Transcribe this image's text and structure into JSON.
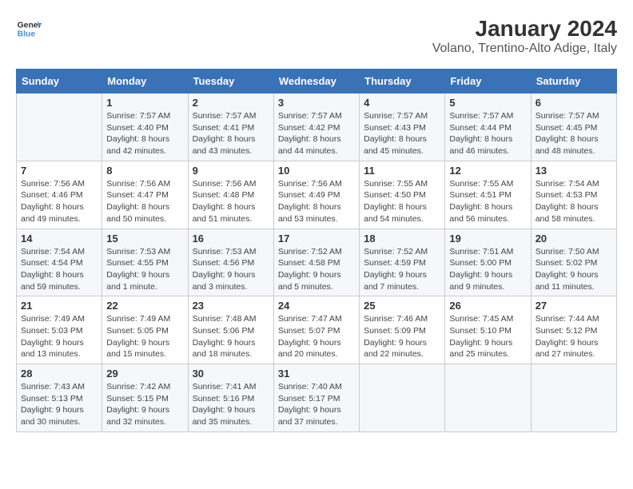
{
  "logo": {
    "line1": "General",
    "line2": "Blue"
  },
  "title": "January 2024",
  "subtitle": "Volano, Trentino-Alto Adige, Italy",
  "days_of_week": [
    "Sunday",
    "Monday",
    "Tuesday",
    "Wednesday",
    "Thursday",
    "Friday",
    "Saturday"
  ],
  "weeks": [
    [
      {
        "day": "",
        "sunrise": "",
        "sunset": "",
        "daylight": ""
      },
      {
        "day": "1",
        "sunrise": "Sunrise: 7:57 AM",
        "sunset": "Sunset: 4:40 PM",
        "daylight": "Daylight: 8 hours and 42 minutes."
      },
      {
        "day": "2",
        "sunrise": "Sunrise: 7:57 AM",
        "sunset": "Sunset: 4:41 PM",
        "daylight": "Daylight: 8 hours and 43 minutes."
      },
      {
        "day": "3",
        "sunrise": "Sunrise: 7:57 AM",
        "sunset": "Sunset: 4:42 PM",
        "daylight": "Daylight: 8 hours and 44 minutes."
      },
      {
        "day": "4",
        "sunrise": "Sunrise: 7:57 AM",
        "sunset": "Sunset: 4:43 PM",
        "daylight": "Daylight: 8 hours and 45 minutes."
      },
      {
        "day": "5",
        "sunrise": "Sunrise: 7:57 AM",
        "sunset": "Sunset: 4:44 PM",
        "daylight": "Daylight: 8 hours and 46 minutes."
      },
      {
        "day": "6",
        "sunrise": "Sunrise: 7:57 AM",
        "sunset": "Sunset: 4:45 PM",
        "daylight": "Daylight: 8 hours and 48 minutes."
      }
    ],
    [
      {
        "day": "7",
        "sunrise": "Sunrise: 7:56 AM",
        "sunset": "Sunset: 4:46 PM",
        "daylight": "Daylight: 8 hours and 49 minutes."
      },
      {
        "day": "8",
        "sunrise": "Sunrise: 7:56 AM",
        "sunset": "Sunset: 4:47 PM",
        "daylight": "Daylight: 8 hours and 50 minutes."
      },
      {
        "day": "9",
        "sunrise": "Sunrise: 7:56 AM",
        "sunset": "Sunset: 4:48 PM",
        "daylight": "Daylight: 8 hours and 51 minutes."
      },
      {
        "day": "10",
        "sunrise": "Sunrise: 7:56 AM",
        "sunset": "Sunset: 4:49 PM",
        "daylight": "Daylight: 8 hours and 53 minutes."
      },
      {
        "day": "11",
        "sunrise": "Sunrise: 7:55 AM",
        "sunset": "Sunset: 4:50 PM",
        "daylight": "Daylight: 8 hours and 54 minutes."
      },
      {
        "day": "12",
        "sunrise": "Sunrise: 7:55 AM",
        "sunset": "Sunset: 4:51 PM",
        "daylight": "Daylight: 8 hours and 56 minutes."
      },
      {
        "day": "13",
        "sunrise": "Sunrise: 7:54 AM",
        "sunset": "Sunset: 4:53 PM",
        "daylight": "Daylight: 8 hours and 58 minutes."
      }
    ],
    [
      {
        "day": "14",
        "sunrise": "Sunrise: 7:54 AM",
        "sunset": "Sunset: 4:54 PM",
        "daylight": "Daylight: 8 hours and 59 minutes."
      },
      {
        "day": "15",
        "sunrise": "Sunrise: 7:53 AM",
        "sunset": "Sunset: 4:55 PM",
        "daylight": "Daylight: 9 hours and 1 minute."
      },
      {
        "day": "16",
        "sunrise": "Sunrise: 7:53 AM",
        "sunset": "Sunset: 4:56 PM",
        "daylight": "Daylight: 9 hours and 3 minutes."
      },
      {
        "day": "17",
        "sunrise": "Sunrise: 7:52 AM",
        "sunset": "Sunset: 4:58 PM",
        "daylight": "Daylight: 9 hours and 5 minutes."
      },
      {
        "day": "18",
        "sunrise": "Sunrise: 7:52 AM",
        "sunset": "Sunset: 4:59 PM",
        "daylight": "Daylight: 9 hours and 7 minutes."
      },
      {
        "day": "19",
        "sunrise": "Sunrise: 7:51 AM",
        "sunset": "Sunset: 5:00 PM",
        "daylight": "Daylight: 9 hours and 9 minutes."
      },
      {
        "day": "20",
        "sunrise": "Sunrise: 7:50 AM",
        "sunset": "Sunset: 5:02 PM",
        "daylight": "Daylight: 9 hours and 11 minutes."
      }
    ],
    [
      {
        "day": "21",
        "sunrise": "Sunrise: 7:49 AM",
        "sunset": "Sunset: 5:03 PM",
        "daylight": "Daylight: 9 hours and 13 minutes."
      },
      {
        "day": "22",
        "sunrise": "Sunrise: 7:49 AM",
        "sunset": "Sunset: 5:05 PM",
        "daylight": "Daylight: 9 hours and 15 minutes."
      },
      {
        "day": "23",
        "sunrise": "Sunrise: 7:48 AM",
        "sunset": "Sunset: 5:06 PM",
        "daylight": "Daylight: 9 hours and 18 minutes."
      },
      {
        "day": "24",
        "sunrise": "Sunrise: 7:47 AM",
        "sunset": "Sunset: 5:07 PM",
        "daylight": "Daylight: 9 hours and 20 minutes."
      },
      {
        "day": "25",
        "sunrise": "Sunrise: 7:46 AM",
        "sunset": "Sunset: 5:09 PM",
        "daylight": "Daylight: 9 hours and 22 minutes."
      },
      {
        "day": "26",
        "sunrise": "Sunrise: 7:45 AM",
        "sunset": "Sunset: 5:10 PM",
        "daylight": "Daylight: 9 hours and 25 minutes."
      },
      {
        "day": "27",
        "sunrise": "Sunrise: 7:44 AM",
        "sunset": "Sunset: 5:12 PM",
        "daylight": "Daylight: 9 hours and 27 minutes."
      }
    ],
    [
      {
        "day": "28",
        "sunrise": "Sunrise: 7:43 AM",
        "sunset": "Sunset: 5:13 PM",
        "daylight": "Daylight: 9 hours and 30 minutes."
      },
      {
        "day": "29",
        "sunrise": "Sunrise: 7:42 AM",
        "sunset": "Sunset: 5:15 PM",
        "daylight": "Daylight: 9 hours and 32 minutes."
      },
      {
        "day": "30",
        "sunrise": "Sunrise: 7:41 AM",
        "sunset": "Sunset: 5:16 PM",
        "daylight": "Daylight: 9 hours and 35 minutes."
      },
      {
        "day": "31",
        "sunrise": "Sunrise: 7:40 AM",
        "sunset": "Sunset: 5:17 PM",
        "daylight": "Daylight: 9 hours and 37 minutes."
      },
      {
        "day": "",
        "sunrise": "",
        "sunset": "",
        "daylight": ""
      },
      {
        "day": "",
        "sunrise": "",
        "sunset": "",
        "daylight": ""
      },
      {
        "day": "",
        "sunrise": "",
        "sunset": "",
        "daylight": ""
      }
    ]
  ]
}
